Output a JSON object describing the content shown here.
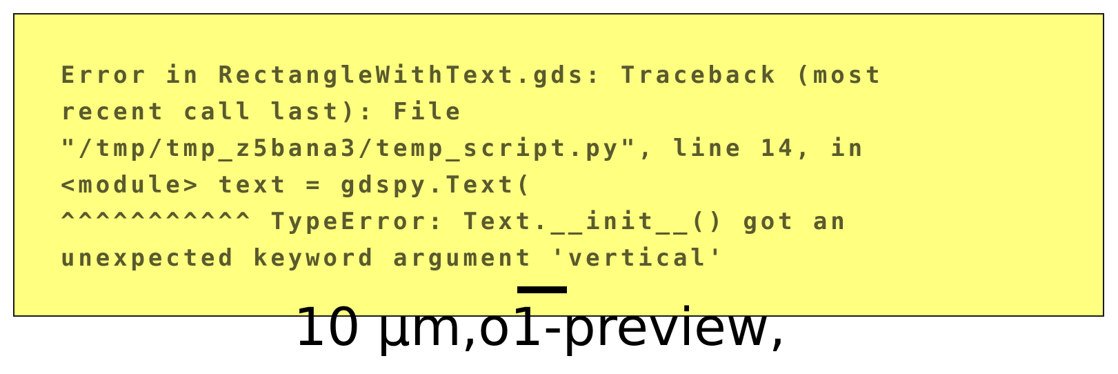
{
  "error_panel": {
    "message": "Error in RectangleWithText.gds:  Traceback (most\nrecent call last):   File\n\"/tmp/tmp_z5bana3/temp_script.py\", line 14, in\n<module>     text = gdspy.Text(\n^^^^^^^^^^^ TypeError: Text.__init__() got an\nunexpected keyword argument 'vertical'",
    "background_color": "#ffff80",
    "text_color": "#5a5a2e"
  },
  "caption": {
    "text": "10 µm,o1-preview,"
  }
}
